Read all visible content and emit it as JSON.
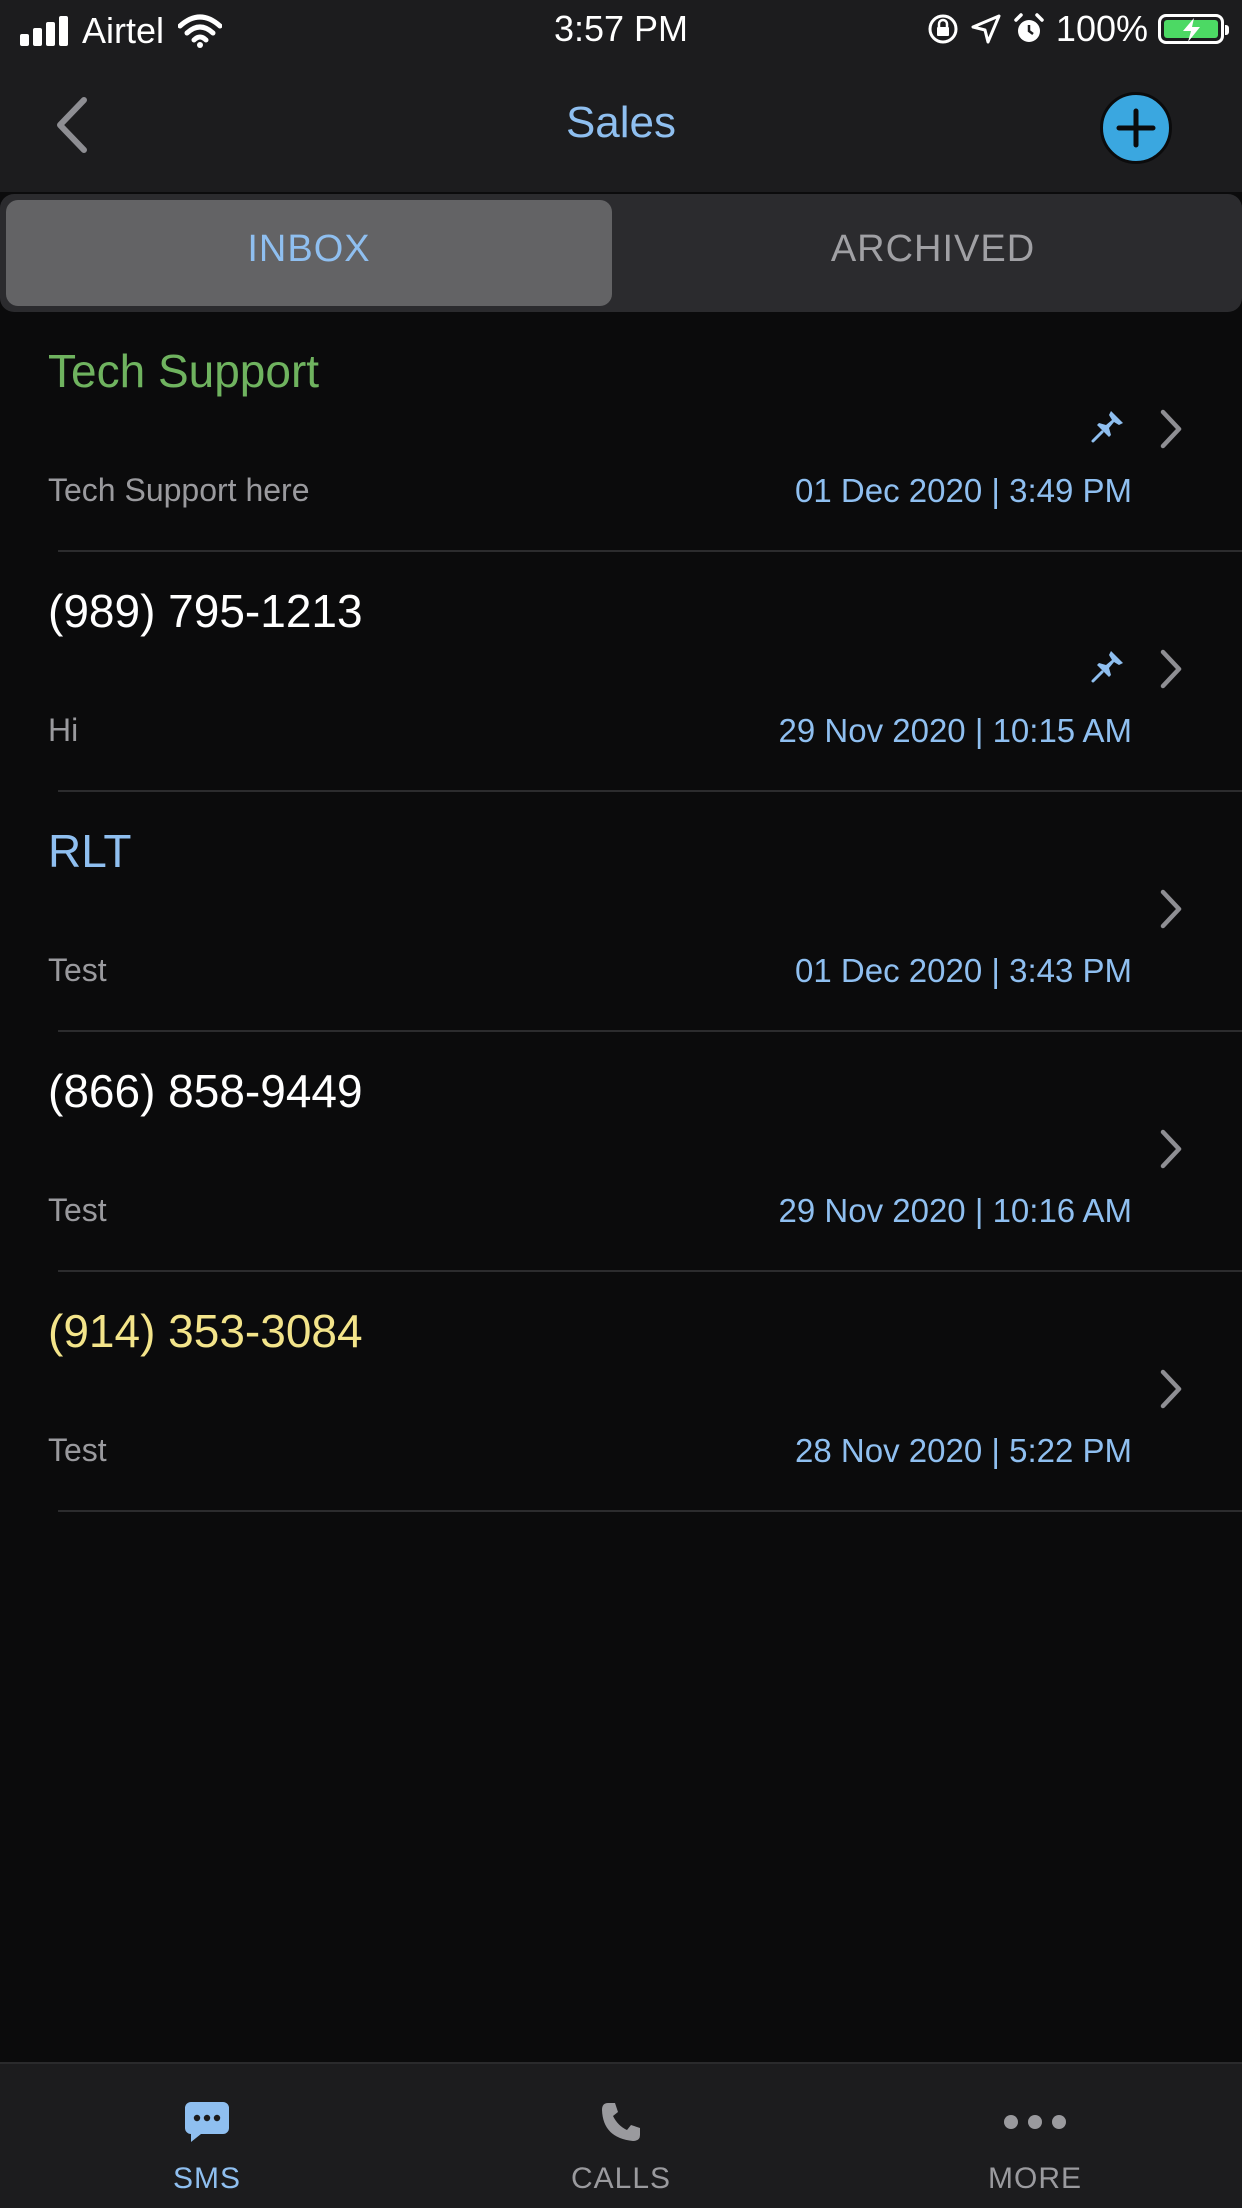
{
  "status_bar": {
    "carrier": "Airtel",
    "time": "3:57 PM",
    "battery_percent": "100%",
    "battery_level": 1.0
  },
  "nav": {
    "title": "Sales",
    "back_icon": "chevron-left-icon",
    "add_icon": "plus-circle-icon"
  },
  "segments": {
    "inbox": "INBOX",
    "archived": "ARCHIVED",
    "selected": "INBOX"
  },
  "conversations": [
    {
      "title": "Tech Support",
      "title_color": "#6fb35f",
      "message": "Tech Support here",
      "date": "01 Dec 2020 | 3:49 PM",
      "pinned": true
    },
    {
      "title": "(989) 795-1213",
      "title_color": "#ffffff",
      "message": "Hi",
      "date": "29 Nov 2020 | 10:15 AM",
      "pinned": true
    },
    {
      "title": "RLT",
      "title_color": "#8fbff0",
      "message": "Test",
      "date": "01 Dec 2020 | 3:43 PM",
      "pinned": false
    },
    {
      "title": "(866) 858-9449",
      "title_color": "#ffffff",
      "message": "Test",
      "date": "29 Nov 2020 | 10:16 AM",
      "pinned": false
    },
    {
      "title": "(914) 353-3084",
      "title_color": "#f3e48a",
      "message": "Test",
      "date": "28 Nov 2020 | 5:22 PM",
      "pinned": false
    }
  ],
  "tabs": [
    {
      "label": "SMS",
      "icon": "chat-bubble-icon",
      "active": true
    },
    {
      "label": "CALLS",
      "icon": "phone-icon",
      "active": false
    },
    {
      "label": "MORE",
      "icon": "more-dots-icon",
      "active": false
    }
  ],
  "colors": {
    "accent": "#8fbff0",
    "add_button": "#3aa7e0",
    "inactive_tab": "#9a9a9e"
  }
}
